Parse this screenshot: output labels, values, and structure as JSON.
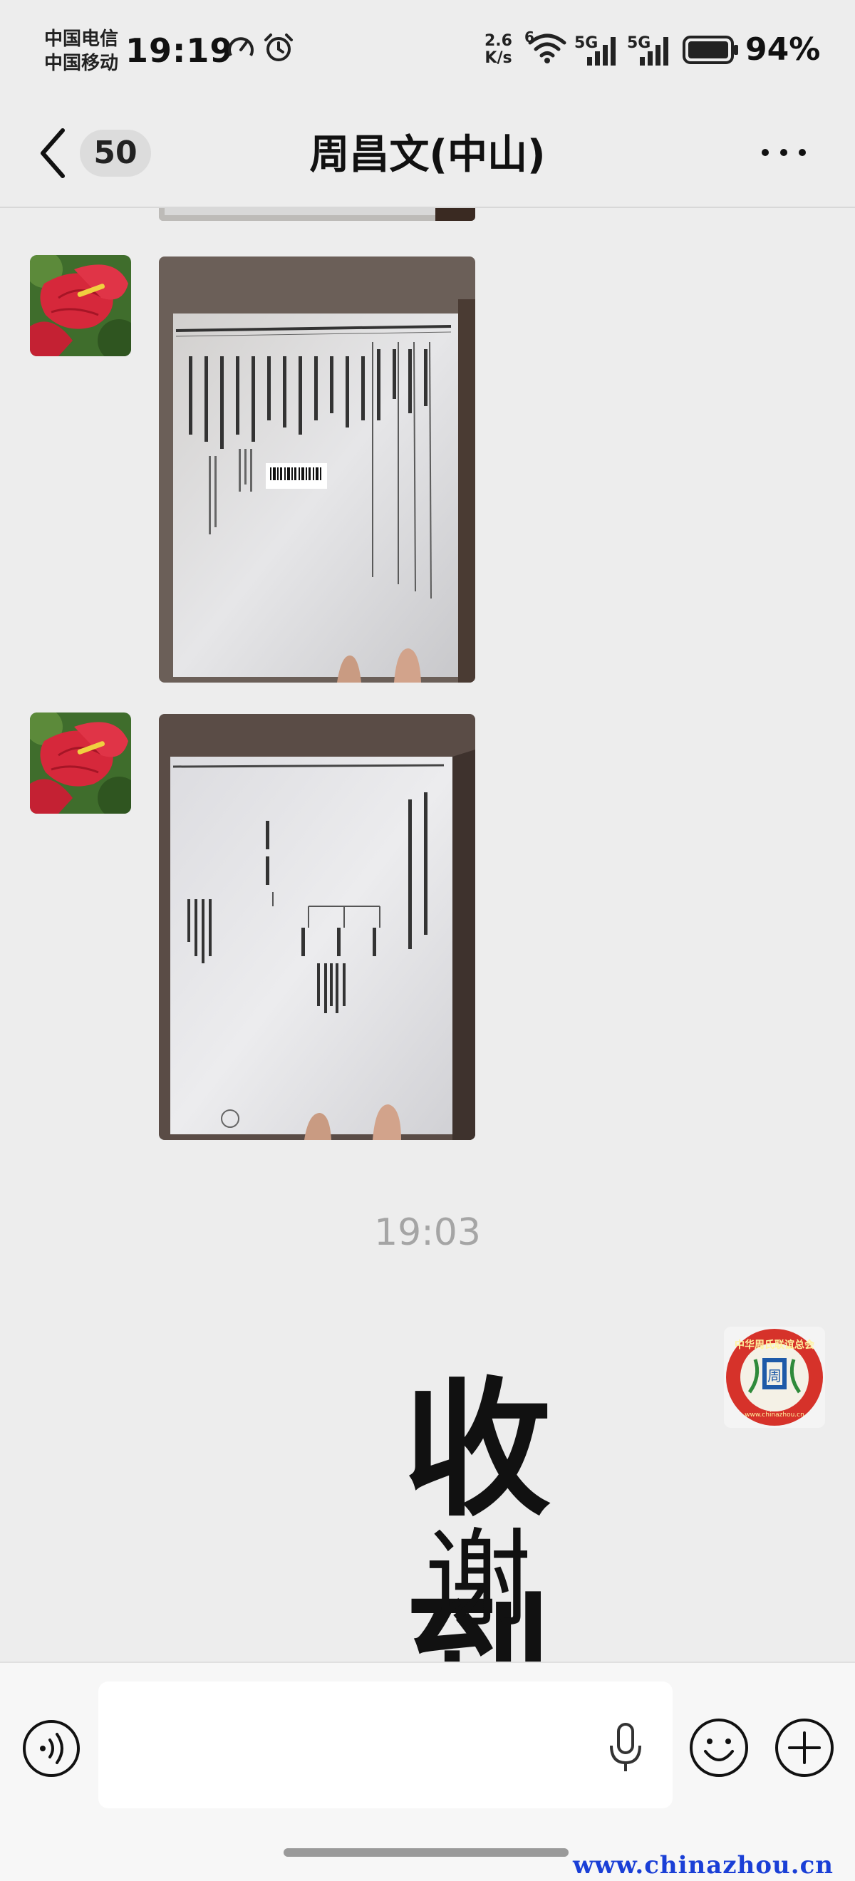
{
  "status_bar": {
    "carrier_1": "中国电信",
    "carrier_2": "中国移动",
    "time": "19:19",
    "net_speed_value": "2.6",
    "net_speed_unit": "K/s",
    "wifi_label": "6",
    "signal_1_label": "5G",
    "signal_2_label": "5G",
    "battery_percent": "94%",
    "icons": [
      "speedometer-icon",
      "alarm-icon",
      "wifi-icon",
      "signal-icon",
      "battery-icon"
    ]
  },
  "nav": {
    "unread_count": "50",
    "chat_title": "周昌文(中山)",
    "icons": [
      "back-icon",
      "more-icon"
    ]
  },
  "messages": [
    {
      "type": "image",
      "sender": "other",
      "content": "genealogy-book-photo"
    },
    {
      "type": "image",
      "sender": "other",
      "content": "genealogy-book-photo"
    }
  ],
  "timestamp": "19:03",
  "sticker": {
    "line_1": "收到",
    "line_2": "谢谢"
  },
  "self_avatar": {
    "text": "中华周氏联谊总会",
    "center_char": "周",
    "url": "www.chinazhou.cn"
  },
  "input_bar": {
    "text_value": "",
    "icons": [
      "voice-toggle-icon",
      "microphone-icon",
      "emoji-icon",
      "plus-icon"
    ]
  },
  "watermark": "www.chinazhou.cn",
  "colors": {
    "background": "#ededed",
    "input_bar": "#f7f7f7",
    "watermark": "#1a3fd6"
  }
}
